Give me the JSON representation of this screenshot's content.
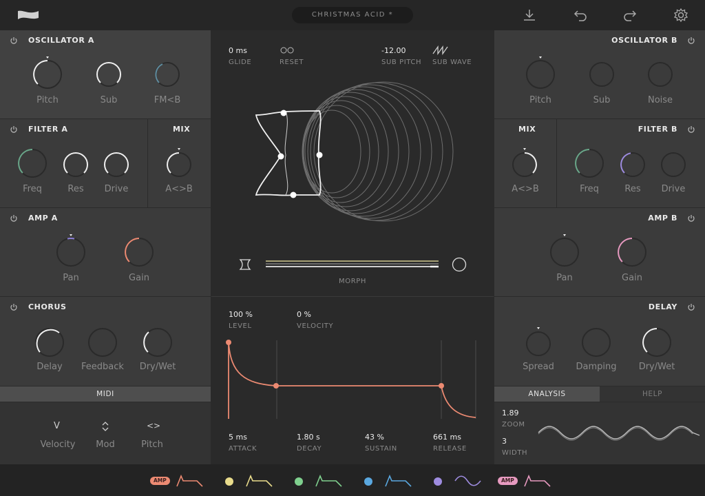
{
  "topbar": {
    "preset_name": "CHRISTMAS ACID *",
    "icons": [
      "logo-icon",
      "download-icon",
      "undo-icon",
      "redo-icon",
      "gear-icon"
    ]
  },
  "osc_a": {
    "title": "OSCILLATOR A",
    "knobs": [
      "Pitch",
      "Sub",
      "FM<B"
    ]
  },
  "filter_a": {
    "title": "FILTER A",
    "knobs": [
      "Freq",
      "Res",
      "Drive"
    ]
  },
  "mix_a": {
    "title": "MIX",
    "knob": "A<>B"
  },
  "amp_a": {
    "title": "AMP A",
    "knobs": [
      "Pan",
      "Gain"
    ]
  },
  "chorus": {
    "title": "CHORUS",
    "knobs": [
      "Delay",
      "Feedback",
      "Dry/Wet"
    ]
  },
  "midi": {
    "tab": "MIDI",
    "items": [
      "Velocity",
      "Mod",
      "Pitch"
    ],
    "glyphs": [
      "V",
      "<>"
    ]
  },
  "osc_b": {
    "title": "OSCILLATOR B",
    "knobs": [
      "Pitch",
      "Sub",
      "Noise"
    ]
  },
  "mix_b": {
    "title": "MIX",
    "knob": "A<>B"
  },
  "filter_b": {
    "title": "FILTER B",
    "knobs": [
      "Freq",
      "Res",
      "Drive"
    ]
  },
  "amp_b": {
    "title": "AMP B",
    "knobs": [
      "Pan",
      "Gain"
    ]
  },
  "delay": {
    "title": "DELAY",
    "knobs": [
      "Spread",
      "Damping",
      "Dry/Wet"
    ]
  },
  "analysis": {
    "tab_active": "ANALYSIS",
    "tab_other": "HELP",
    "zoom_value": "1.89",
    "zoom_label": "ZOOM",
    "width_value": "3",
    "width_label": "WIDTH"
  },
  "wave": {
    "glide_value": "0 ms",
    "glide_label": "GLIDE",
    "reset_label": "RESET",
    "sub_pitch_value": "-12.00",
    "sub_pitch_label": "SUB PITCH",
    "sub_wave_label": "SUB WAVE",
    "morph_label": "MORPH"
  },
  "envelope": {
    "level_value": "100 %",
    "level_label": "LEVEL",
    "velocity_value": "0 %",
    "velocity_label": "VELOCITY",
    "attack_value": "5 ms",
    "attack_label": "ATTACK",
    "decay_value": "1.80 s",
    "decay_label": "DECAY",
    "sustain_value": "43 %",
    "sustain_label": "SUSTAIN",
    "release_value": "661 ms",
    "release_label": "RELEASE"
  },
  "mod_bar": {
    "badge1": "AMP",
    "badge2": "AMP"
  },
  "colors": {
    "env": "#ec8a72",
    "accent_pink": "#e79ac0",
    "purple": "#9e8ce0",
    "green": "#6fbf8a",
    "blue": "#5aa8e0",
    "yellow": "#e9dc8c"
  }
}
